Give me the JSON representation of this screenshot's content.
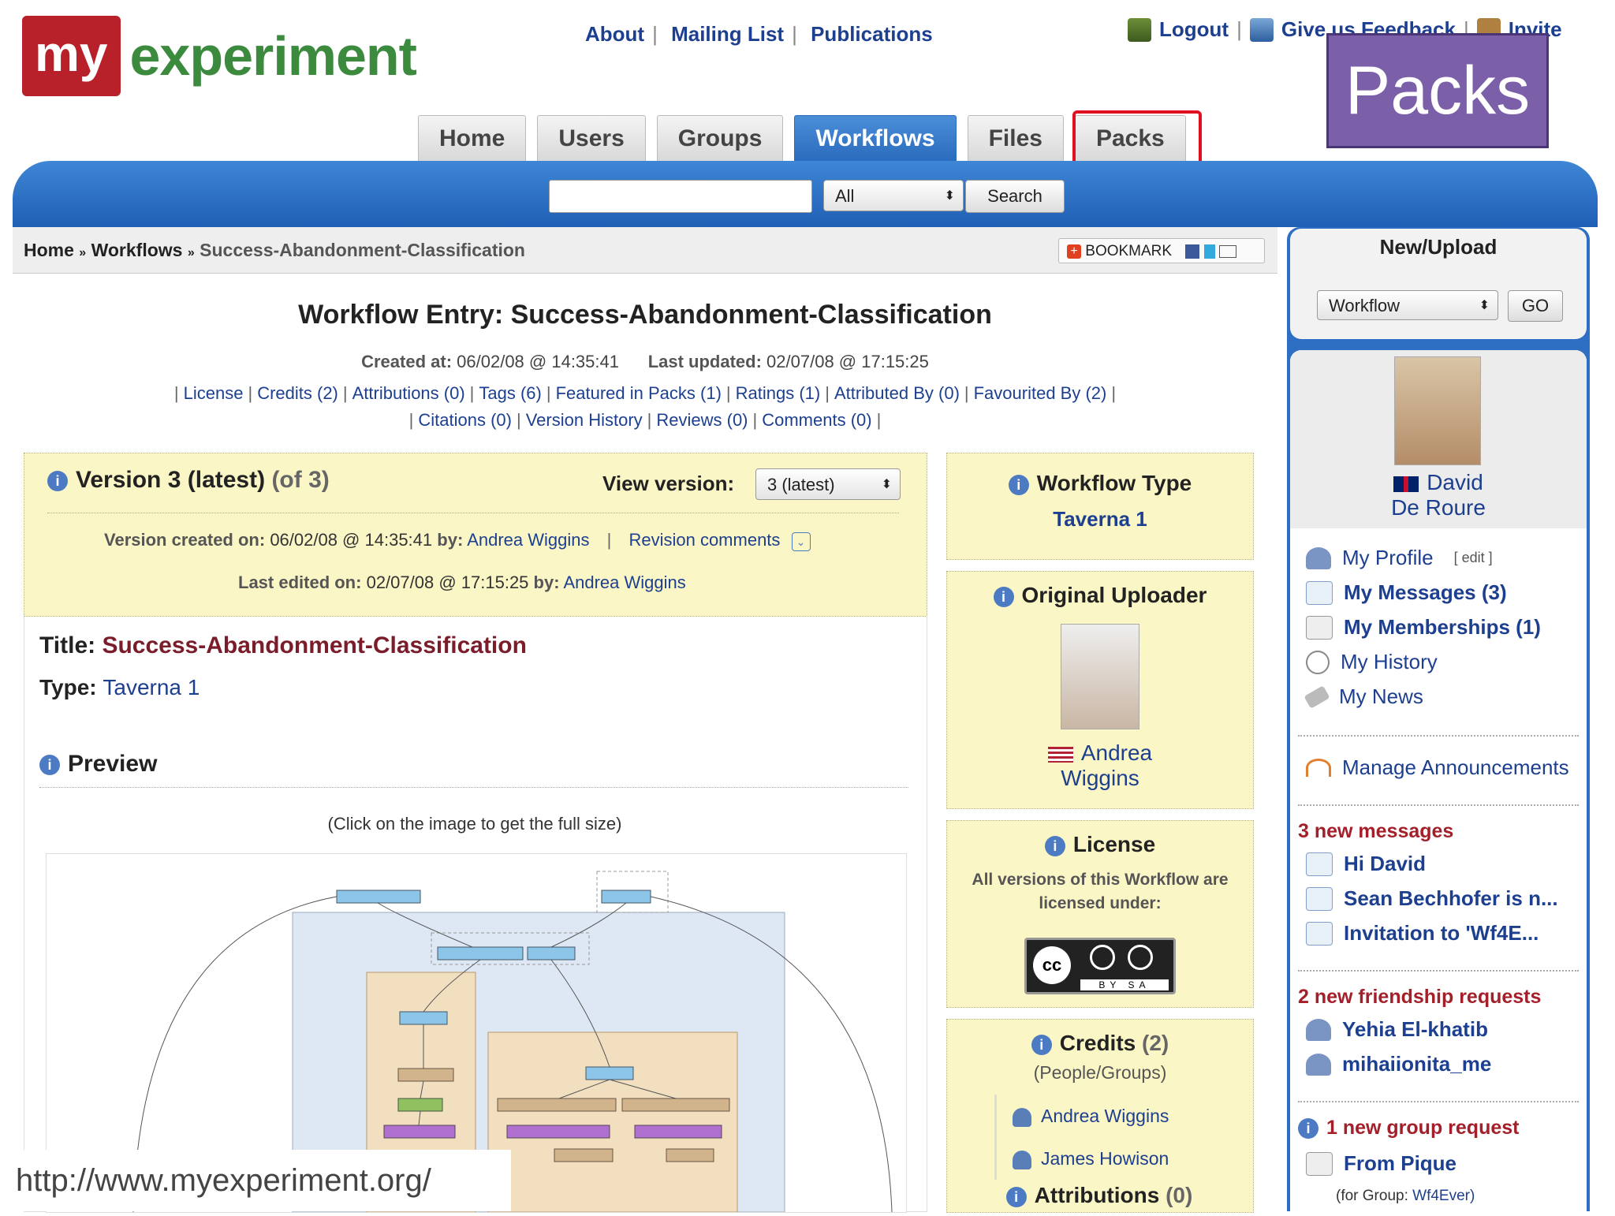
{
  "logo": {
    "my": "my",
    "experiment": "experiment"
  },
  "top_links": [
    "About",
    "Mailing List",
    "Publications"
  ],
  "user_links": {
    "logout": "Logout",
    "feedback": "Give us Feedback",
    "invite": "Invite"
  },
  "overlay_label": "Packs",
  "tabs": [
    {
      "label": "Home",
      "active": false
    },
    {
      "label": "Users",
      "active": false
    },
    {
      "label": "Groups",
      "active": false
    },
    {
      "label": "Workflows",
      "active": true
    },
    {
      "label": "Files",
      "active": false
    },
    {
      "label": "Packs",
      "active": false
    }
  ],
  "search": {
    "value": "",
    "scope": "All",
    "button": "Search"
  },
  "breadcrumb": {
    "home": "Home",
    "sep": "»",
    "workflows": "Workflows",
    "current": "Success-Abandonment-Classification"
  },
  "bookmark": {
    "label": "BOOKMARK"
  },
  "page": {
    "title": "Workflow Entry: Success-Abandonment-Classification",
    "created_label": "Created at:",
    "created": "06/02/08 @ 14:35:41",
    "updated_label": "Last updated:",
    "updated": "02/07/08 @ 17:15:25",
    "links_row1": [
      "License",
      "Credits (2)",
      "Attributions (0)",
      "Tags (6)",
      "Featured in Packs (1)",
      "Ratings (1)",
      "Attributed By (0)",
      "Favourited By (2)"
    ],
    "links_row2": [
      "Citations (0)",
      "Version History",
      "Reviews (0)",
      "Comments (0)"
    ]
  },
  "version": {
    "heading": "Version 3 (latest)",
    "of": "(of 3)",
    "view_label": "View version:",
    "view_value": "3 (latest)",
    "created_label": "Version created on:",
    "created": "06/02/08 @ 14:35:41",
    "by_label": "by:",
    "created_by": "Andrea Wiggins",
    "revision": "Revision comments",
    "edited_label": "Last edited on:",
    "edited": "02/07/08 @ 17:15:25",
    "edited_by": "Andrea Wiggins"
  },
  "details": {
    "title_label": "Title:",
    "title": "Success-Abandonment-Classification",
    "type_label": "Type:",
    "type": "Taverna 1",
    "preview": "Preview",
    "click_hint": "(Click on the image to get the full size)"
  },
  "url_caption": "http://www.myexperiment.org/",
  "workflow_type": {
    "heading": "Workflow Type",
    "value": "Taverna 1"
  },
  "uploader": {
    "heading": "Original Uploader",
    "name1": "Andrea",
    "name2": "Wiggins"
  },
  "license": {
    "heading": "License",
    "text1": "All versions of this Workflow are",
    "text2": "licensed under:",
    "badge": "BY SA"
  },
  "credits": {
    "heading": "Credits",
    "count": "(2)",
    "sub": "(People/Groups)",
    "people": [
      "Andrea Wiggins",
      "James Howison"
    ]
  },
  "attributions": {
    "heading": "Attributions",
    "count": "(0)"
  },
  "sidebar": {
    "new_upload": "New/Upload",
    "upload_type": "Workflow",
    "go": "GO",
    "user_first": "David",
    "user_last": "De Roure",
    "menu": [
      {
        "label": "My Profile",
        "extra": "[ edit ]",
        "bold": false
      },
      {
        "label": "My Messages (3)",
        "bold": true
      },
      {
        "label": "My Memberships (1)",
        "bold": true
      },
      {
        "label": "My History",
        "bold": false
      },
      {
        "label": "My News",
        "bold": false
      }
    ],
    "manage": "Manage Announcements",
    "new_messages": "3 new messages",
    "messages": [
      "Hi David",
      "Sean Bechhofer is n...",
      "Invitation to 'Wf4E..."
    ],
    "new_friends": "2 new friendship requests",
    "friends": [
      "Yehia El-khatib",
      "mihaiionita_me"
    ],
    "new_group": "1 new group request",
    "group_from": "From Pique",
    "group_label": "(for Group:",
    "group_name": "Wf4Ever)"
  }
}
